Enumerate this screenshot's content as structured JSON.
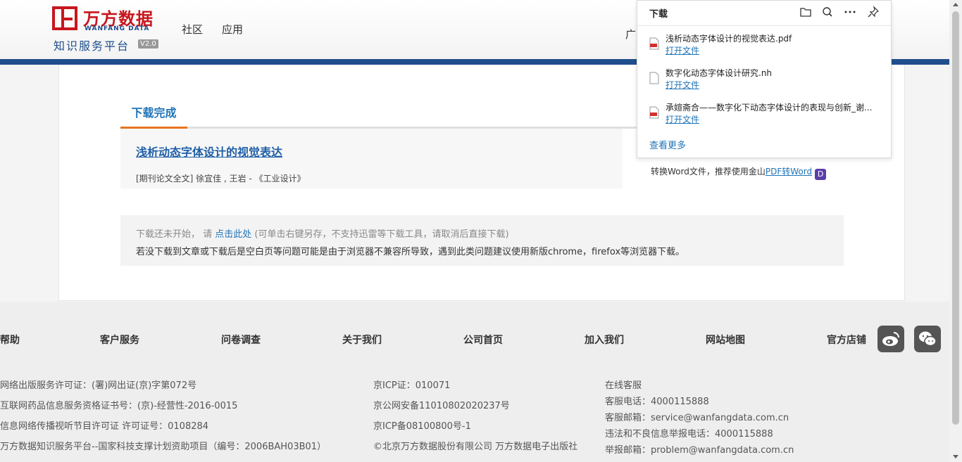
{
  "header": {
    "logo_cn": "万方数据",
    "logo_en": "WANFANG DATA",
    "platform": "知识服务平台",
    "version": "V2.0",
    "nav": [
      "社区",
      "应用"
    ],
    "nav_partial": "广"
  },
  "main": {
    "tab_label": "下载完成",
    "article_title": "浅析动态字体设计的视觉表达",
    "article_meta": "[期刊论文全文] 徐宜佳 , 王岩 - 《工业设计》",
    "word_prefix": "转换Word文件，推荐使用金山",
    "word_link": "PDF转Word",
    "word_icon": "D",
    "notice_prefix": "下载还未开始，  请 ",
    "notice_link": "点击此处",
    "notice_suffix": " (可单击右键另存，不支持迅雷等下载工具，请取消后直接下载)",
    "notice_line2": "若没下载到文章或下载后是空白页等问题可能是由于浏览器不兼容所导致，遇到此类问题建议使用新版chrome，firefox等浏览器下载。"
  },
  "footer": {
    "links": [
      "帮助",
      "客户服务",
      "问卷调查",
      "关于我们",
      "公司首页",
      "加入我们",
      "网站地图",
      "官方店铺"
    ],
    "col1": [
      "网络出版服务许可证：(署)网出证(京)字第072号",
      "互联网药品信息服务资格证书号：(京)-经营性-2016-0015",
      "信息网络传播视听节目许可证 许可证号：0108284",
      "万方数据知识服务平台--国家科技支撑计划资助项目（编号：2006BAH03B01）"
    ],
    "col2": [
      "京ICP证：010071",
      "京公网安备11010802020237号",
      "京ICP备08100800号-1",
      "©北京万方数据股份有限公司 万方数据电子出版社"
    ],
    "col3": [
      "在线客服",
      "客服电话：4000115888",
      "客服邮箱：service@wanfangdata.com.cn",
      "违法和不良信息举报电话：4000115888",
      "举报邮箱：problem@wanfangdata.com.cn"
    ]
  },
  "downloads": {
    "title": "下载",
    "items": [
      {
        "name": "浅析动态字体设计的视觉表达.pdf",
        "action": "打开文件",
        "type": "pdf"
      },
      {
        "name": "数字化动态字体设计研究.nh",
        "action": "打开文件",
        "type": "file"
      },
      {
        "name": "承媗斋合——数字化下动态字体设计的表现与创新_谢...",
        "action": "打开文件",
        "type": "pdf"
      }
    ],
    "more": "查看更多"
  },
  "colors": {
    "brand_red": "#c8161d",
    "brand_blue": "#1f4e8c",
    "link_blue": "#1f74b8",
    "tab_orange": "#e8741f"
  }
}
